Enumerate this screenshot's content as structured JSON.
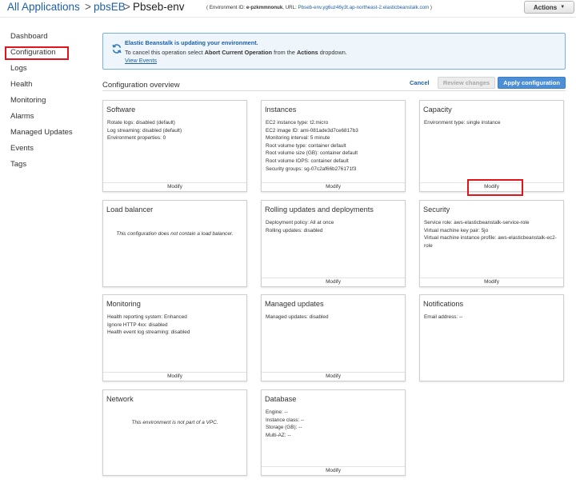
{
  "header": {
    "breadcrumb": [
      {
        "label": "All Applications"
      },
      {
        "label": "pbsEB"
      },
      {
        "label": "Pbseb-env"
      }
    ],
    "separator": ">",
    "env_id_label": "( Environment ID: ",
    "env_id": "e-pzkmmnonuk",
    "url_label": ", URL: ",
    "url": "Pbseb-env.yg6uz46y3t.ap-northeast-2.elasticbeanstalk.com",
    "env_suffix": " )",
    "actions_label": "Actions",
    "actions_caret": "▼"
  },
  "sidebar": {
    "items": [
      {
        "label": "Dashboard"
      },
      {
        "label": "Configuration"
      },
      {
        "label": "Logs"
      },
      {
        "label": "Health"
      },
      {
        "label": "Monitoring"
      },
      {
        "label": "Alarms"
      },
      {
        "label": "Managed Updates"
      },
      {
        "label": "Events"
      },
      {
        "label": "Tags"
      }
    ]
  },
  "banner": {
    "title": "Elastic Beanstalk is updating your environment.",
    "body_pre": "To cancel this operation select ",
    "body_strong1": "Abort Current Operation",
    "body_mid": " from the ",
    "body_strong2": "Actions",
    "body_post": " dropdown.",
    "link": "View Events"
  },
  "overview": {
    "title": "Configuration overview",
    "cancel": "Cancel",
    "review": "Review changes",
    "apply": "Apply configuration"
  },
  "cards": [
    {
      "title": "Software",
      "lines": [
        "Rotate logs: disabled (default)",
        "Log streaming: disabled (default)",
        "Environment properties: 0"
      ],
      "footer": "Modify"
    },
    {
      "title": "Instances",
      "lines": [
        "EC2 instance type: t2.micro",
        "EC2 image ID: ami-081ade3d7ce6817b3",
        "Monitoring interval: 5 minute",
        "Root volume type: container default",
        "Root volume size (GB): container default",
        "Root volume IOPS: container default",
        "Security groups: sg-07c2af66b276171f3"
      ],
      "footer": "Modify"
    },
    {
      "title": "Capacity",
      "lines": [
        "Environment type: single instance"
      ],
      "footer": "Modify"
    },
    {
      "title": "Load balancer",
      "note": "This configuration does not contain a load balancer."
    },
    {
      "title": "Rolling updates and deployments",
      "lines": [
        "Deployment policy: All at once",
        "Rolling updates: disabled"
      ],
      "footer": "Modify"
    },
    {
      "title": "Security",
      "lines": [
        "Service role: aws-elasticbeanstalk-service-role",
        "Virtual machine key pair: 5jo",
        "Virtual machine instance profile: aws-elasticbeanstalk-ec2-role"
      ],
      "footer": "Modify"
    },
    {
      "title": "Monitoring",
      "lines": [
        "Health reporting system: Enhanced",
        "Ignore HTTP 4xx: disabled",
        "Health event log streaming: disabled"
      ],
      "footer": "Modify"
    },
    {
      "title": "Managed updates",
      "lines": [
        "Managed updates: disabled"
      ],
      "footer": "Modify"
    },
    {
      "title": "Notifications",
      "lines": [
        "Email address: --"
      ]
    },
    {
      "title": "Network",
      "note": "This environment is not part of a VPC."
    },
    {
      "title": "Database",
      "lines": [
        "Engine: --",
        "Instance class: --",
        "Storage (GB): --",
        "Multi-AZ: --"
      ],
      "footer": "Modify"
    }
  ],
  "colors": {
    "link": "#1f5fa8",
    "highlight": "#e2141b",
    "apply_button": "#4c8fd6",
    "banner_bg": "#eef6fc"
  }
}
